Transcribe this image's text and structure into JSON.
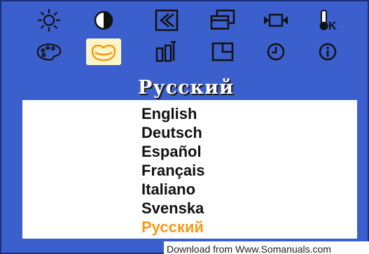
{
  "osd": {
    "menu_icons_row1": [
      {
        "name": "brightness-icon"
      },
      {
        "name": "contrast-icon"
      },
      {
        "name": "position-icon"
      },
      {
        "name": "size-icon"
      },
      {
        "name": "image-lock-icon"
      },
      {
        "name": "temperature-icon"
      }
    ],
    "menu_icons_row2": [
      {
        "name": "color-palette-icon"
      },
      {
        "name": "language-icon",
        "selected": true
      },
      {
        "name": "recall-icon"
      },
      {
        "name": "menu-position-icon"
      },
      {
        "name": "timer-icon"
      },
      {
        "name": "information-icon"
      }
    ],
    "title": "Русский",
    "languages": [
      {
        "label": "English"
      },
      {
        "label": "Deutsch"
      },
      {
        "label": "Español"
      },
      {
        "label": "Français"
      },
      {
        "label": "Italiano"
      },
      {
        "label": "Svenska"
      },
      {
        "label": "Русский",
        "selected": true
      }
    ],
    "footer_text": "Download from Www.Somanuals.com"
  },
  "colors": {
    "background": "#3b5fcc",
    "selected_text": "#f59a1a",
    "selected_icon_bg": "#fdf5c8"
  }
}
